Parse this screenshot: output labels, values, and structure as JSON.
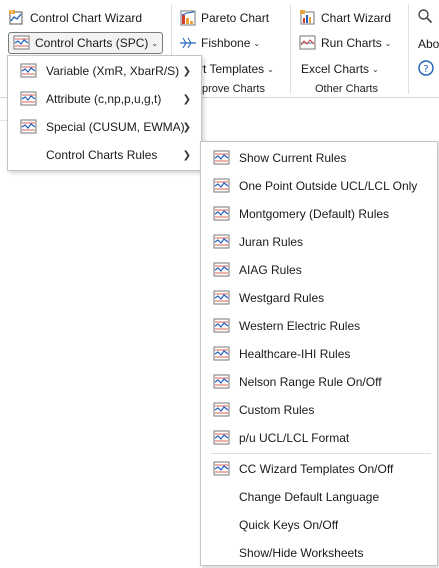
{
  "ribbon": {
    "control_chart_wizard": "Control Chart Wizard",
    "control_charts_spc": "Control Charts (SPC)",
    "pareto_chart": "Pareto Chart",
    "fishbone": "Fishbone",
    "chart_templates_partial": "rt Templates",
    "improve_charts_partial": "prove Charts",
    "chart_wizard": "Chart Wizard",
    "run_charts": "Run Charts",
    "excel_charts": "Excel Charts",
    "other_charts": "Other Charts",
    "about_partial": "Abo",
    "help_glyph": "?"
  },
  "spc_menu": {
    "items": [
      {
        "label": "Variable (XmR, XbarR/S)",
        "icon": "chart-line-icon",
        "has_submenu": true
      },
      {
        "label": "Attribute (c,np,p,u,g,t)",
        "icon": "chart-line-icon",
        "has_submenu": true
      },
      {
        "label": "Special (CUSUM, EWMA)",
        "icon": "chart-line-icon",
        "has_submenu": true
      },
      {
        "label": "Control Charts Rules",
        "icon": "",
        "has_submenu": true
      }
    ]
  },
  "rules_menu": {
    "items": [
      {
        "label": "Show Current Rules",
        "icon": "chart-line-icon"
      },
      {
        "label": "One Point Outside UCL/LCL Only",
        "icon": "chart-line-icon"
      },
      {
        "label": "Montgomery (Default) Rules",
        "icon": "chart-line-icon"
      },
      {
        "label": "Juran Rules",
        "icon": "chart-line-icon"
      },
      {
        "label": "AIAG Rules",
        "icon": "chart-line-icon"
      },
      {
        "label": "Westgard Rules",
        "icon": "chart-line-icon"
      },
      {
        "label": "Western Electric Rules",
        "icon": "chart-line-icon"
      },
      {
        "label": "Healthcare-IHI Rules",
        "icon": "chart-line-icon"
      },
      {
        "label": "Nelson Range Rule On/Off",
        "icon": "chart-line-icon"
      },
      {
        "label": "Custom Rules",
        "icon": "chart-line-icon"
      },
      {
        "label": "p/u UCL/LCL Format",
        "icon": "chart-line-icon"
      },
      {
        "label": "CC Wizard Templates On/Off",
        "icon": "chart-line-icon"
      },
      {
        "label": "Change Default Language",
        "icon": ""
      },
      {
        "label": "Quick Keys On/Off",
        "icon": ""
      },
      {
        "label": "Show/Hide Worksheets",
        "icon": ""
      }
    ]
  },
  "colors": {
    "accent_blue": "#1f5fbf",
    "icon_red": "#d23a2a",
    "icon_orange": "#e8a33a"
  }
}
